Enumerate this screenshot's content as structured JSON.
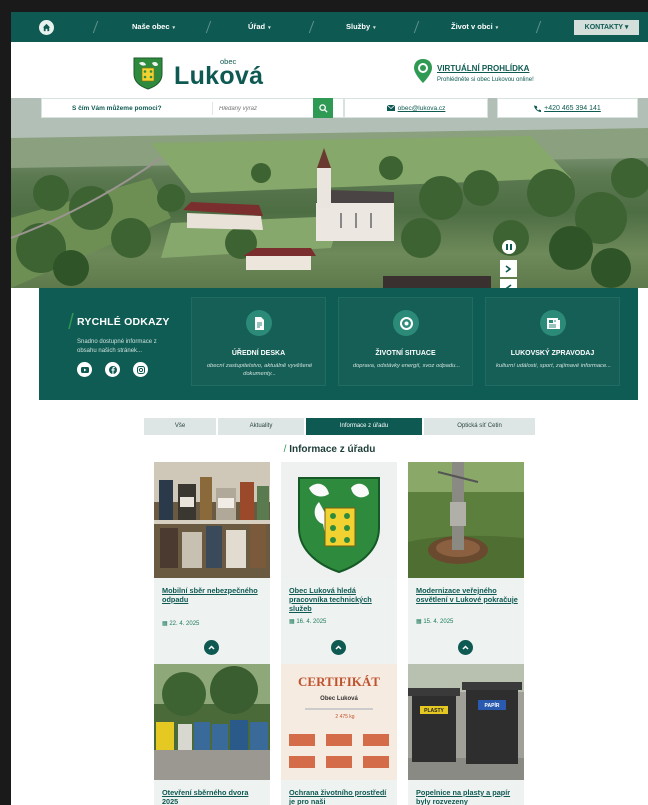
{
  "nav": {
    "items": [
      {
        "label": "Naše obec",
        "caret": "▾"
      },
      {
        "label": "Úřad",
        "caret": "▾"
      },
      {
        "label": "Služby",
        "caret": "▾"
      },
      {
        "label": "Život v obci",
        "caret": "▾"
      }
    ],
    "contact_label": "KONTAKTY ▾"
  },
  "header": {
    "obec": "obec",
    "name": "Luková",
    "virtual_title": "VIRTUÁLNÍ PROHLÍDKA",
    "virtual_sub": "Prohlédněte si obec Lukovou online!"
  },
  "search": {
    "question": "S čím Vám můžeme pomoci?",
    "placeholder": "Hledaný výraz"
  },
  "contact": {
    "email": "obec@lukova.cz",
    "phone": "+420 465 394 141"
  },
  "quick_links": {
    "title": "RYCHLÉ ODKAZY",
    "description": "Snadno dostupné informace z obsahu našich stránek...",
    "cards": [
      {
        "name": "ÚŘEDNÍ DESKA",
        "sub": "obecní zastupitelstvo, aktuálně vyvěšené dokumenty..."
      },
      {
        "name": "ŽIVOTNÍ SITUACE",
        "sub": "doprava, odstávky energií, svoz odpadu..."
      },
      {
        "name": "LUKOVSKÝ ZPRAVODAJ",
        "sub": "kulturní události, sport, zajímavé informace..."
      }
    ]
  },
  "tabs": [
    "Vše",
    "Aktuality",
    "Informace z úřadu",
    "Optická síť Cetin"
  ],
  "active_tab": "Informace z úřadu",
  "section_title": "Informace z úřadu",
  "articles": [
    {
      "title": "Mobilní sběr nebezpečného odpadu",
      "date": "22. 4. 2025"
    },
    {
      "title": "Obec Luková hledá pracovníka technických služeb",
      "date": "16. 4. 2025"
    },
    {
      "title": "Modernizace veřejného osvětlení v Lukové pokračuje",
      "date": "15. 4. 2025"
    },
    {
      "title": "Otevření sběrného dvora 2025",
      "date": ""
    },
    {
      "title": "Ochrana životního prostředí je pro naši",
      "date": ""
    },
    {
      "title": "Popelnice na plasty a papír byly rozvezeny",
      "date": ""
    }
  ],
  "certificate": {
    "title": "CERTIFIKÁT",
    "org": "Obec Luková",
    "amount": "2 475 kg",
    "bin_label_1": "PLASTY",
    "bin_label_2": "PAPÍR"
  },
  "colors": {
    "primary": "#0e5a52",
    "accent": "#2f9a54",
    "light": "#eef2f1"
  }
}
